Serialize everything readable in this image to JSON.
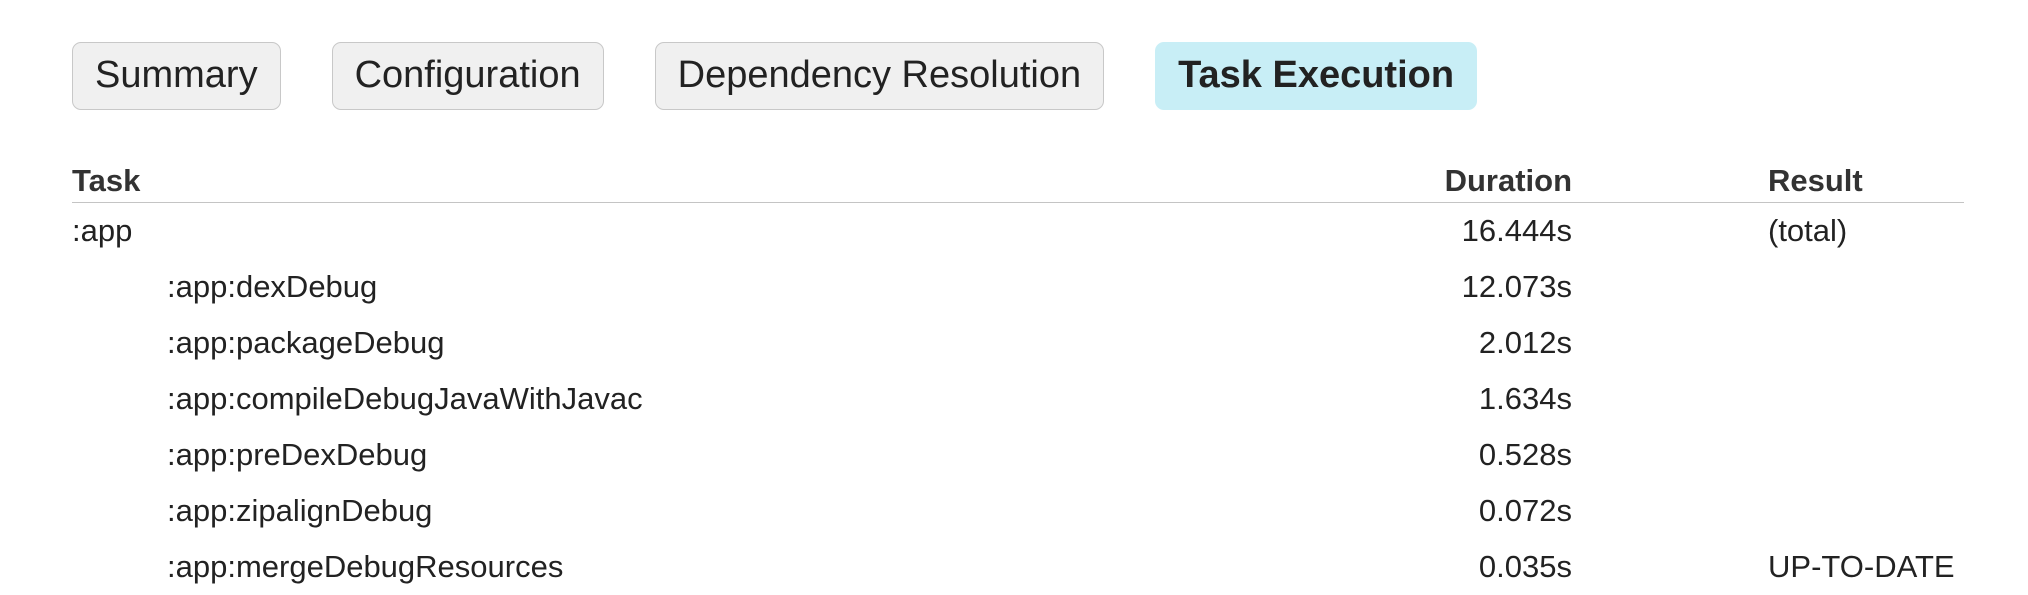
{
  "tabs": [
    {
      "label": "Summary",
      "active": false
    },
    {
      "label": "Configuration",
      "active": false
    },
    {
      "label": "Dependency Resolution",
      "active": false
    },
    {
      "label": "Task Execution",
      "active": true
    }
  ],
  "colors": {
    "active_tab_background": "#c8eef6",
    "inactive_tab_background": "#f0f0f0",
    "tab_border": "#c8c8c8",
    "header_rule": "#c4c4c4"
  },
  "table": {
    "headers": {
      "task": "Task",
      "duration": "Duration",
      "result": "Result"
    },
    "rows": [
      {
        "task": ":app",
        "duration": "16.444s",
        "result": "(total)",
        "level": 0
      },
      {
        "task": ":app:dexDebug",
        "duration": "12.073s",
        "result": "",
        "level": 1
      },
      {
        "task": ":app:packageDebug",
        "duration": "2.012s",
        "result": "",
        "level": 1
      },
      {
        "task": ":app:compileDebugJavaWithJavac",
        "duration": "1.634s",
        "result": "",
        "level": 1
      },
      {
        "task": ":app:preDexDebug",
        "duration": "0.528s",
        "result": "",
        "level": 1
      },
      {
        "task": ":app:zipalignDebug",
        "duration": "0.072s",
        "result": "",
        "level": 1
      },
      {
        "task": ":app:mergeDebugResources",
        "duration": "0.035s",
        "result": "UP-TO-DATE",
        "level": 1
      }
    ]
  }
}
